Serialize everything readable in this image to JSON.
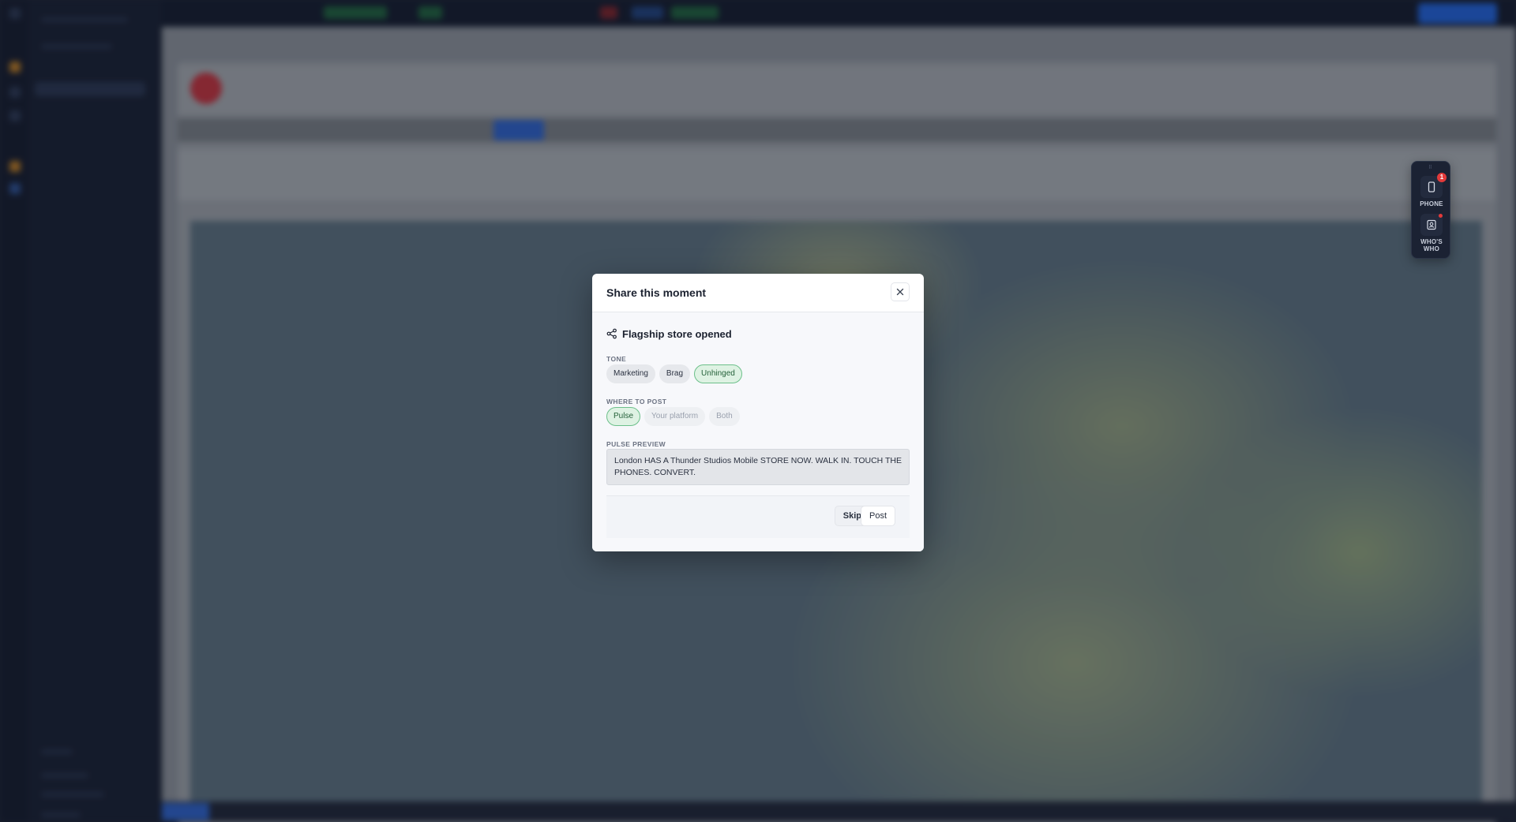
{
  "modal": {
    "title": "Share this moment",
    "moment_title": "Flagship store opened",
    "tone_label": "TONE",
    "tone_options": [
      "Marketing",
      "Brag",
      "Unhinged"
    ],
    "tone_selected": "Unhinged",
    "where_label": "WHERE TO POST",
    "where_options": [
      "Pulse",
      "Your platform",
      "Both"
    ],
    "where_selected": "Pulse",
    "preview_label": "PULSE PREVIEW",
    "preview_text": "London HAS A Thunder Studios Mobile STORE NOW. WALK IN. TOUCH THE PHONES. CONVERT.",
    "skip_label": "Skip",
    "post_label": "Post"
  },
  "dock": {
    "grip": "⠿",
    "phone_label": "PHONE",
    "phone_badge": "1",
    "whos_who_label": "WHO'S WHO"
  },
  "colors": {
    "accent_green": "#6cc08a",
    "badge_red": "#e23a3a",
    "topbar_blue": "#1f5fd6"
  },
  "icons": {
    "close": "close-icon",
    "share": "share-icon",
    "phone": "phone-icon",
    "contact": "contact-card-icon"
  }
}
